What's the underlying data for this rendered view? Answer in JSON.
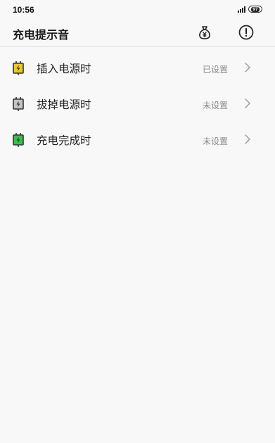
{
  "status_bar": {
    "time": "10:56",
    "battery": "97"
  },
  "header": {
    "title": "充电提示音",
    "icons": [
      "money-bag-icon",
      "info-icon"
    ]
  },
  "items": [
    {
      "label": "插入电源时",
      "status": "已设置",
      "icon_color": "#f2c81a",
      "icon": "plug-icon"
    },
    {
      "label": "拔掉电源时",
      "status": "未设置",
      "icon_color": "#c4c4c4",
      "icon": "unplug-icon"
    },
    {
      "label": "充电完成时",
      "status": "未设置",
      "icon_color": "#36c24a",
      "icon": "full-charge-icon"
    }
  ]
}
